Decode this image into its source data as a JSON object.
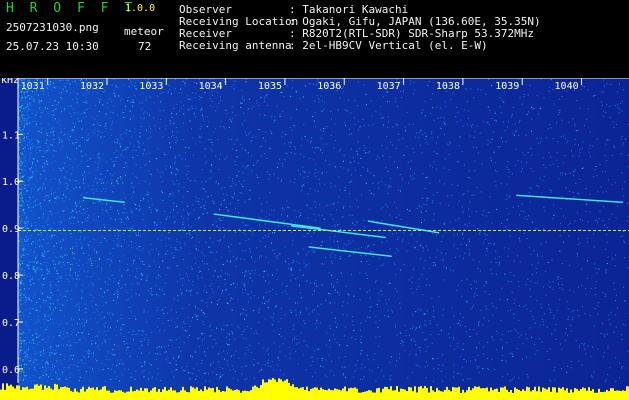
{
  "header": {
    "title": "H R O F F T",
    "version": "1.0.0",
    "filename": "2507231030.png",
    "timestamp": "25.07.23 10:30",
    "meteor_label": "meteor",
    "meteor_count": "72"
  },
  "info": [
    {
      "label": "Observer",
      "value": ": Takanori Kawachi"
    },
    {
      "label": "Receiving Location",
      "value": ": Ogaki, Gifu, JAPAN (136.60E, 35.35N)"
    },
    {
      "label": "Receiver",
      "value": ": R820T2(RTL-SDR) SDR-Sharp 53.372MHz"
    },
    {
      "label": "Receiving antenna",
      "value": ": 2el-HB9CV Vertical (el. E-W)"
    }
  ],
  "chart_data": {
    "type": "heatmap",
    "ylabel": "kHz",
    "yticks": [
      "1.1",
      "1.0",
      "0.9",
      "0.8",
      "0.7",
      "0.6"
    ],
    "xticks": [
      "1031",
      "1032",
      "1033",
      "1034",
      "1035",
      "1036",
      "1037",
      "1038",
      "1039",
      "1040"
    ],
    "ylim": [
      0.57,
      1.22
    ],
    "xlim": [
      1030.5,
      1040.8
    ],
    "colors": {
      "background": "#0a1c8c",
      "noise_hi": "#1a7fff",
      "noise_cyan": "#30d8e8",
      "trail": "#40f0ff",
      "carrier": "#b8e8ff",
      "level": "#ffff00",
      "axis": "#ffffff"
    },
    "carrier_khz": 0.895,
    "meteor_trails": [
      {
        "x": [
          1033.8,
          1035.6
        ],
        "y": [
          0.93,
          0.9
        ]
      },
      {
        "x": [
          1035.1,
          1036.7
        ],
        "y": [
          0.905,
          0.88
        ]
      },
      {
        "x": [
          1035.4,
          1036.8
        ],
        "y": [
          0.86,
          0.84
        ]
      },
      {
        "x": [
          1036.4,
          1037.6
        ],
        "y": [
          0.915,
          0.89
        ]
      },
      {
        "x": [
          1038.9,
          1040.7
        ],
        "y": [
          0.97,
          0.955
        ]
      },
      {
        "x": [
          1031.6,
          1032.3
        ],
        "y": [
          0.965,
          0.955
        ]
      }
    ]
  }
}
